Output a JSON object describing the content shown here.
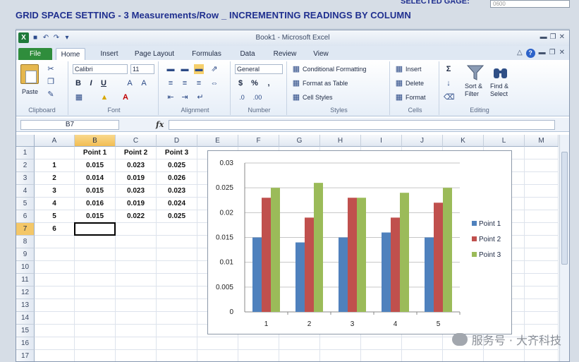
{
  "app": {
    "title": "GRID SPACE SETTING - 3 Measurements/Row _ INCREMENTING READINGS BY COLUMN",
    "selected_gage_label": "SELECTED GAGE:",
    "selected_gage_value": "0600"
  },
  "excel": {
    "window_title": "Book1 - Microsoft Excel",
    "tabs": [
      "File",
      "Home",
      "Insert",
      "Page Layout",
      "Formulas",
      "Data",
      "Review",
      "View"
    ],
    "ribbon": {
      "clipboard": {
        "label": "Clipboard",
        "paste": "Paste"
      },
      "font": {
        "label": "Font",
        "font_name": "Calibri",
        "font_size": "11"
      },
      "alignment": {
        "label": "Alignment"
      },
      "number": {
        "label": "Number",
        "format": "General"
      },
      "styles": {
        "label": "Styles",
        "conditional": "Conditional Formatting",
        "format_table": "Format as Table",
        "cell_styles": "Cell Styles"
      },
      "cells": {
        "label": "Cells",
        "insert": "Insert",
        "delete": "Delete",
        "format": "Format"
      },
      "editing": {
        "label": "Editing",
        "sort_filter_1": "Sort &",
        "sort_filter_2": "Filter",
        "find_1": "Find &",
        "find_2": "Select"
      }
    },
    "name_box": "B7",
    "fx_label": "fx",
    "columns": [
      "A",
      "B",
      "C",
      "D",
      "E",
      "F",
      "G",
      "H",
      "I",
      "J",
      "K",
      "L",
      "M"
    ],
    "rows": [
      "1",
      "2",
      "3",
      "4",
      "5",
      "6",
      "7",
      "8",
      "9",
      "10",
      "11",
      "12",
      "13",
      "14",
      "15",
      "16",
      "17"
    ],
    "table": {
      "headers": [
        "Point 1",
        "Point 2",
        "Point 3"
      ],
      "row_ids": [
        "1",
        "2",
        "3",
        "4",
        "5",
        "6"
      ],
      "values": [
        [
          "0.015",
          "0.023",
          "0.025"
        ],
        [
          "0.014",
          "0.019",
          "0.026"
        ],
        [
          "0.015",
          "0.023",
          "0.023"
        ],
        [
          "0.016",
          "0.019",
          "0.024"
        ],
        [
          "0.015",
          "0.022",
          "0.025"
        ]
      ]
    }
  },
  "chart_data": {
    "type": "bar",
    "categories": [
      "1",
      "2",
      "3",
      "4",
      "5"
    ],
    "series": [
      {
        "name": "Point 1",
        "values": [
          0.015,
          0.014,
          0.015,
          0.016,
          0.015
        ],
        "color": "#4f81bd"
      },
      {
        "name": "Point 2",
        "values": [
          0.023,
          0.019,
          0.023,
          0.019,
          0.022
        ],
        "color": "#c0504d"
      },
      {
        "name": "Point 3",
        "values": [
          0.025,
          0.026,
          0.023,
          0.024,
          0.025
        ],
        "color": "#9bbb59"
      }
    ],
    "ylim": [
      0,
      0.03
    ],
    "yticks": [
      "0",
      "0.005",
      "0.01",
      "0.015",
      "0.02",
      "0.025",
      "0.03"
    ],
    "legend": "right",
    "grid": true
  },
  "watermark": "服务号 · 大齐科技"
}
